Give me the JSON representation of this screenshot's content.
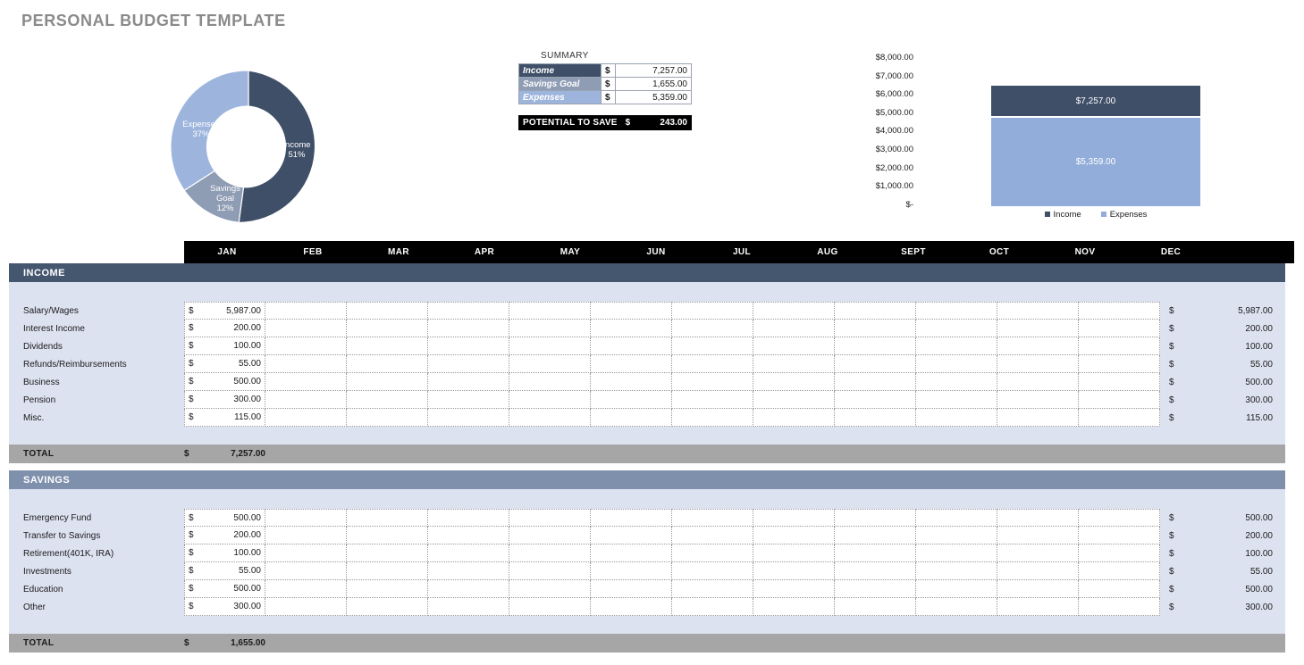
{
  "page": {
    "title": "PERSONAL BUDGET TEMPLATE"
  },
  "colors": {
    "income": "#3f4f68",
    "savings": "#8e9cb4",
    "expenses": "#9db4dd",
    "header_black": "#000000",
    "total_gray": "#a6a6a6",
    "body_lavender": "#dde2f0"
  },
  "summary": {
    "caption": "SUMMARY",
    "rows": [
      {
        "label": "Income",
        "currency": "$",
        "value": "7,257.00"
      },
      {
        "label": "Savings Goal",
        "currency": "$",
        "value": "1,655.00"
      },
      {
        "label": "Expenses",
        "currency": "$",
        "value": "5,359.00"
      }
    ],
    "potential": {
      "label": "POTENTIAL TO SAVE",
      "currency": "$",
      "value": "243.00"
    }
  },
  "chart_data": [
    {
      "type": "pie",
      "variant": "donut",
      "title": "",
      "labels": [
        "Income",
        "Savings Goal",
        "Expenses"
      ],
      "values": [
        7257,
        1655,
        5359
      ],
      "percent_labels": [
        "51%",
        "12%",
        "37%"
      ],
      "slice_label_lines": [
        [
          "Income",
          "51%"
        ],
        [
          "Savings",
          "Goal",
          "12%"
        ],
        [
          "Expenses",
          "37%"
        ]
      ],
      "colors": [
        "#3f4f68",
        "#8e9cb4",
        "#9db4dd"
      ],
      "legend": "none",
      "grid": false
    },
    {
      "type": "bar",
      "title": "",
      "categories": [
        "Income",
        "Expenses"
      ],
      "values": [
        7257,
        5359
      ],
      "value_labels": [
        "$7,257.00",
        "$5,359.00"
      ],
      "colors": [
        "#3f4f68",
        "#92add9"
      ],
      "legend": [
        "Income",
        "Expenses"
      ],
      "legend_position": "bottom",
      "xlabel": "",
      "ylabel": "",
      "ylim": [
        0,
        8000
      ],
      "grid": false,
      "yticks": [
        "$8,000.00",
        "$7,000.00",
        "$6,000.00",
        "$5,000.00",
        "$4,000.00",
        "$3,000.00",
        "$2,000.00",
        "$1,000.00",
        "$-"
      ]
    }
  ],
  "table": {
    "months": [
      "JAN",
      "FEB",
      "MAR",
      "APR",
      "MAY",
      "JUN",
      "JUL",
      "AUG",
      "SEPT",
      "OCT",
      "NOV",
      "DEC"
    ],
    "currency": "$",
    "total_label": "TOTAL",
    "sections": [
      {
        "name": "INCOME",
        "rows": [
          {
            "label": "Salary/Wages",
            "jan": "5,987.00",
            "total": "5,987.00"
          },
          {
            "label": "Interest Income",
            "jan": "200.00",
            "total": "200.00"
          },
          {
            "label": "Dividends",
            "jan": "100.00",
            "total": "100.00"
          },
          {
            "label": "Refunds/Reimbursements",
            "jan": "55.00",
            "total": "55.00"
          },
          {
            "label": "Business",
            "jan": "500.00",
            "total": "500.00"
          },
          {
            "label": "Pension",
            "jan": "300.00",
            "total": "300.00"
          },
          {
            "label": "Misc.",
            "jan": "115.00",
            "total": "115.00"
          }
        ],
        "total": "7,257.00"
      },
      {
        "name": "SAVINGS",
        "rows": [
          {
            "label": "Emergency Fund",
            "jan": "500.00",
            "total": "500.00"
          },
          {
            "label": "Transfer to Savings",
            "jan": "200.00",
            "total": "200.00"
          },
          {
            "label": "Retirement(401K, IRA)",
            "jan": "100.00",
            "total": "100.00"
          },
          {
            "label": "Investments",
            "jan": "55.00",
            "total": "55.00"
          },
          {
            "label": "Education",
            "jan": "500.00",
            "total": "500.00"
          },
          {
            "label": "Other",
            "jan": "300.00",
            "total": "300.00"
          }
        ],
        "total": "1,655.00"
      }
    ]
  }
}
